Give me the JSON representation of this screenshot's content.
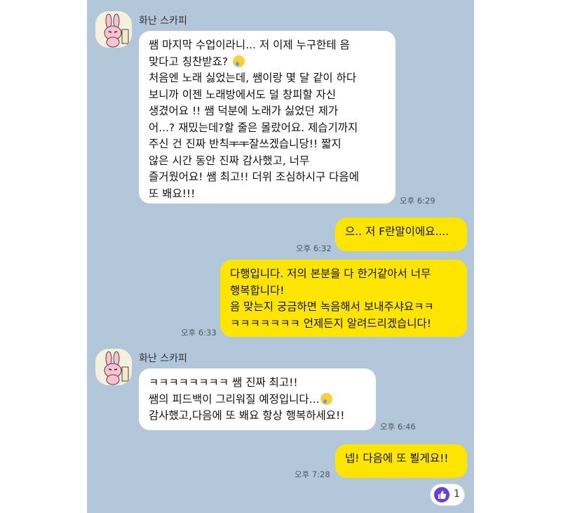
{
  "messages": [
    {
      "sender": "화난 스카피",
      "lines": [
        "쌤 마지막 수업이라니... 저 이제 누구한테 음",
        "맞다고 칭찬받죠?",
        "처음엔 노래 싫었는데, 쌤이랑 몇 달 같이 하다",
        "보니까 이젠 노래방에서도 덜 창피할 자신",
        "생겼어요 !! 쌤 덕분에 노래가 싫었던 제가",
        "어...? 재밌는데?할 줄은 몰랐어요. 제습기까지",
        "주신 건 진짜 반칙",
        "ㅜㅜ",
        "잘쓰겠습니당!! 짧지",
        "않은 시간 동안 진짜 감사했고, 너무",
        "즐거웠어요! 쌤 최고!! 더위 조심하시구 다음에",
        "또 봬요!!!"
      ],
      "time": "오후 6:29"
    },
    {
      "lines": [
        "으.. 저 F란말이에요...."
      ],
      "time": "오후 6:32"
    },
    {
      "lines": [
        "다행입니다. 저의 본분을 다 한거같아서 너무",
        "행복합니다!",
        "음 맞는지 궁금하면 녹음해서 보내주샤요ㅋㅋ",
        "ㅋㅋㅋㅋㅋㅋㅋ 언제든지 알려드리겠습니다!"
      ],
      "time": "오후 6:33"
    },
    {
      "sender": "화난 스카피",
      "lines": [
        " ㅋㅋㅋㅋㅋㅋㅋㅋ 쌤 진짜 최고!!",
        "쌤의 피드백이 그리워질 예정입니다...",
        "감사했고,다음에 또 봬요 항상 행복하세요!!"
      ],
      "time": "오후 6:46"
    },
    {
      "lines": [
        "넵! 다음에 또 뵐게요!!"
      ],
      "time": "오후 7:28"
    }
  ],
  "reaction": {
    "icon": "thumbs-up-icon",
    "count": "1"
  }
}
